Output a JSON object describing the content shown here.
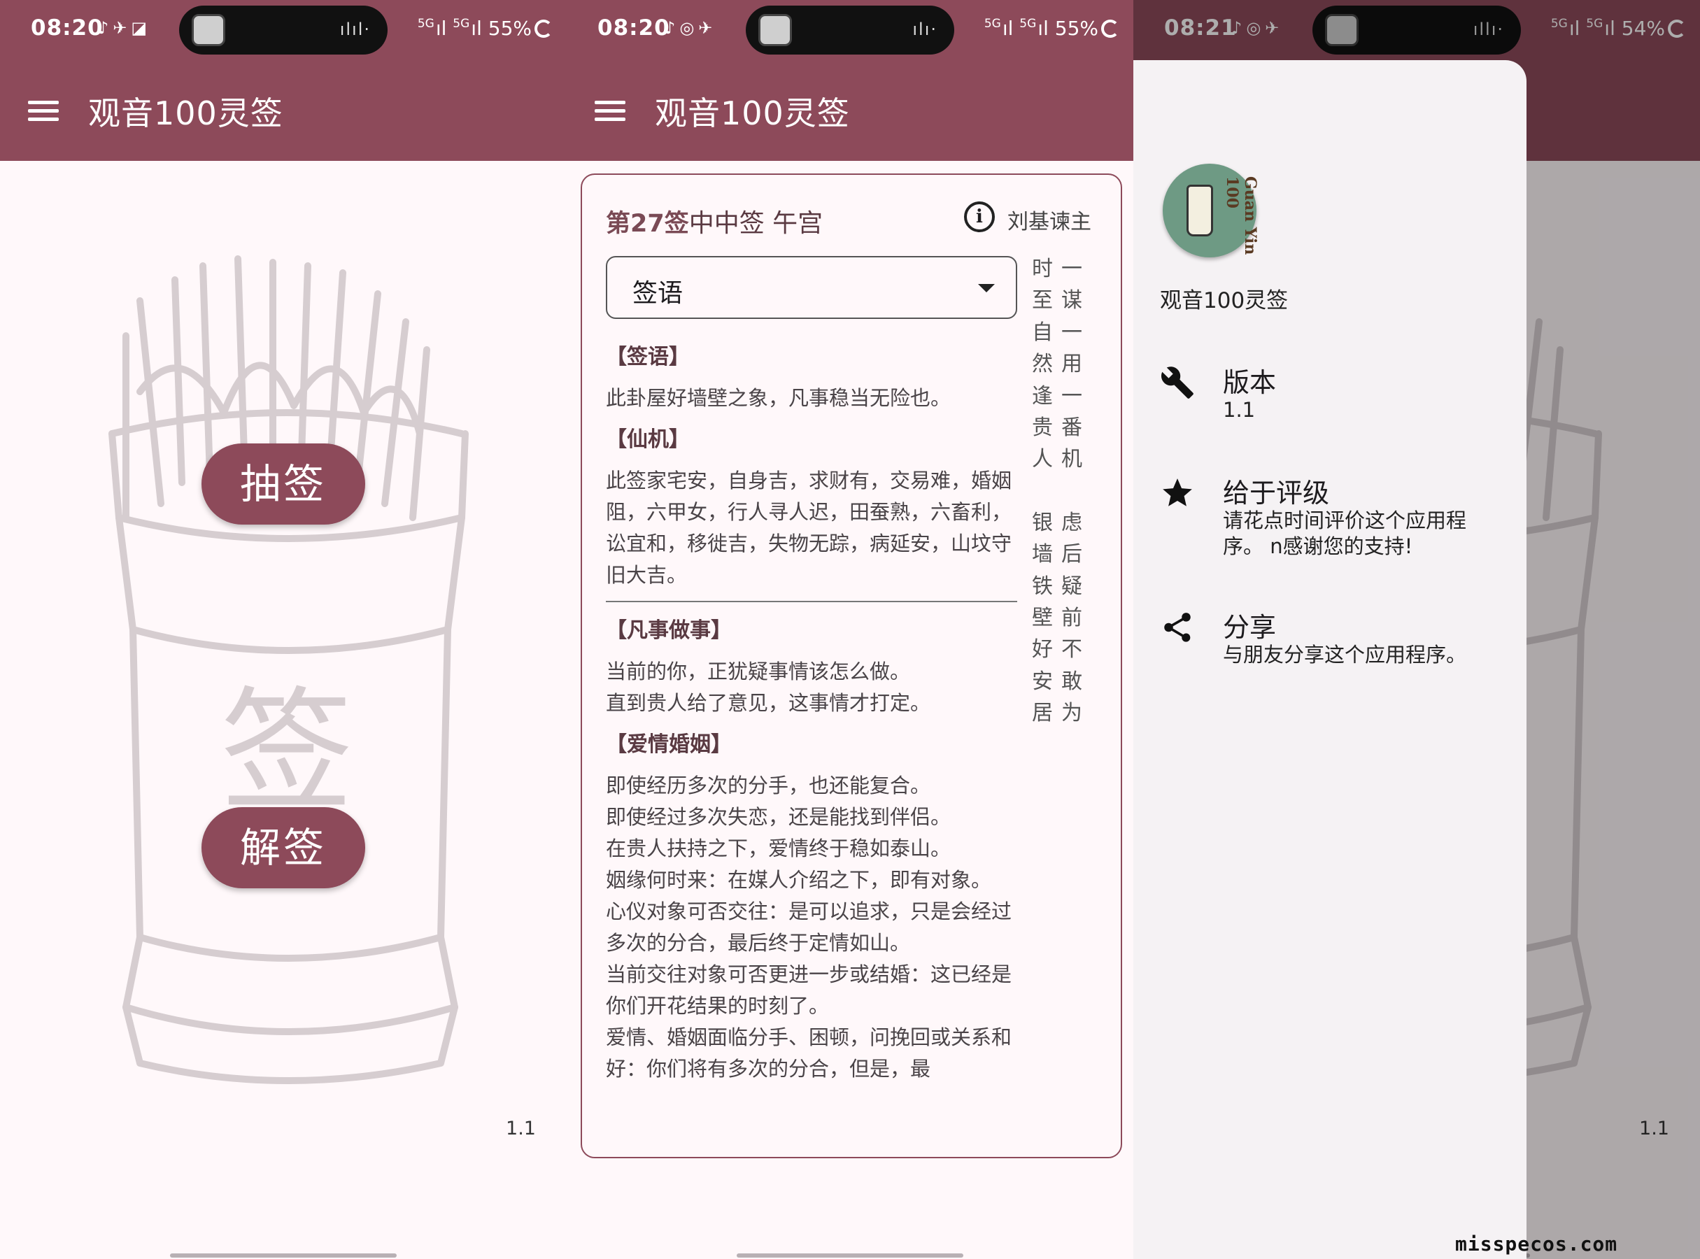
{
  "app": {
    "title": "观音100灵签",
    "version": "1.1"
  },
  "status": [
    {
      "time": "08:20",
      "net": "5G",
      "battery": "55%"
    },
    {
      "time": "08:20",
      "net": "5G",
      "battery": "55%"
    },
    {
      "time": "08:21",
      "net": "5G",
      "battery": "54%"
    }
  ],
  "home": {
    "cup_char": "签",
    "draw_button": "抽签",
    "explain_button": "解签"
  },
  "lot": {
    "number": "第27签",
    "grade": "中中签 午宫",
    "author": "刘基谏主",
    "dropdown_selected": "签语",
    "sections": [
      {
        "heading": "【签语】",
        "text": "此卦屋好墙壁之象，凡事稳当无险也。"
      },
      {
        "heading": "【仙机】",
        "text": "此签家宅安，自身吉，求财有，交易难，婚姻阻，六甲女，行人寻人迟，田蚕熟，六畜利，讼宜和，移徙吉，失物无踪，病延安，山坟守 旧大吉。"
      },
      {
        "heading": "【凡事做事】",
        "text": "当前的你，正犹疑事情该怎么做。\n直到贵人给了意见，这事情才打定。"
      },
      {
        "heading": "【爱情婚姻】",
        "text": "即使经历多次的分手，也还能复合。\n即使经过多次失恋，还是能找到伴侣。\n在贵人扶持之下，爱情终于稳如泰山。\n 姻缘何时来：在媒人介绍之下，即有对象。\n 心仪对象可否交往：是可以追求，只是会经过多次的分合，最后终于定情如山。\n 当前交往对象可否更进一步或结婚：这已经是你们开花结果的时刻了。\n 爱情、婚姻面临分手、困顿，问挽回或关系和好：你们将有多次的分合，但是，最"
      }
    ],
    "verse_left_top": "时至自然逢贵人",
    "verse_left_bottom": "银墙铁壁好安居",
    "verse_right_top": "一谋一用一番机",
    "verse_right_bottom": "虑后疑前不敢为"
  },
  "drawer": {
    "title": "观音100灵签",
    "logo_text": "Guan Yin 100",
    "items": [
      {
        "icon": "wrench-icon",
        "label": "版本",
        "sub": "1.1"
      },
      {
        "icon": "star-icon",
        "label": "给于评级",
        "sub": "请花点时间评价这个应用程序。 n感谢您的支持!"
      },
      {
        "icon": "share-icon",
        "label": "分享",
        "sub": "与朋友分享这个应用程序。"
      }
    ]
  },
  "watermark": "misspecos.com",
  "colors": {
    "primary": "#8d4a5a",
    "background": "#fff8fa",
    "cup_line": "#d6cdd0"
  }
}
